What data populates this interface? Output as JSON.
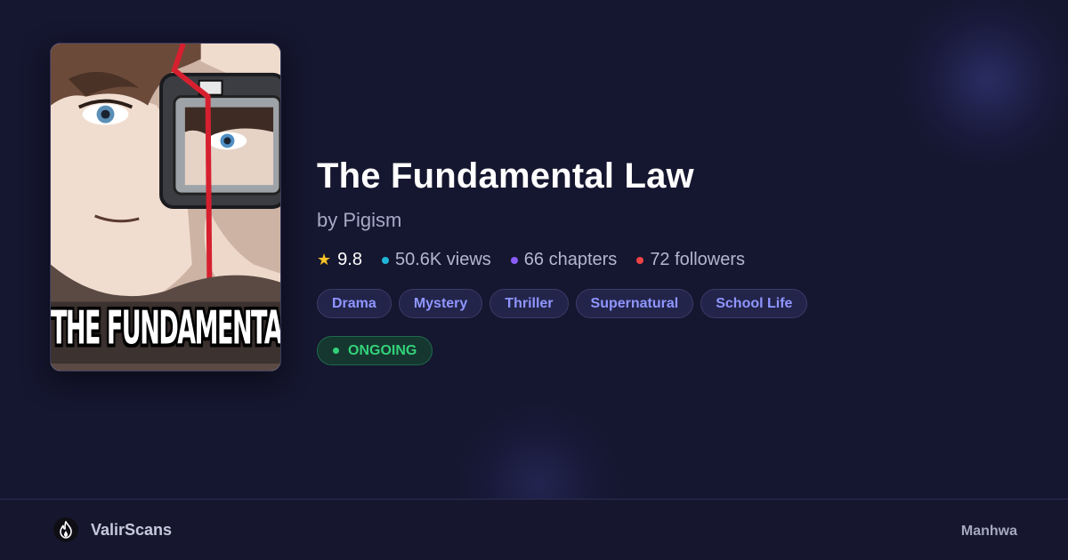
{
  "series": {
    "title": "The Fundamental Law",
    "author": "by Pigism",
    "cover_title": "THE FUNDAMENTAL LAW",
    "rating": "9.8",
    "views": "50.6K views",
    "chapters": "66 chapters",
    "followers": "72 followers",
    "genres": [
      "Drama",
      "Mystery",
      "Thriller",
      "Supernatural",
      "School Life"
    ],
    "status": "ONGOING"
  },
  "footer": {
    "brand": "ValirScans",
    "category": "Manhwa"
  },
  "colors": {
    "background": "#15162f",
    "star": "#f7c325",
    "views_dot": "#1fb6d6",
    "chapters_dot": "#8b5cf6",
    "followers_dot": "#ef4444",
    "tag_text": "#8f96ff",
    "status_green": "#33d17a"
  },
  "icons": {
    "rating": "star-icon",
    "brand": "flame-logo-icon"
  }
}
